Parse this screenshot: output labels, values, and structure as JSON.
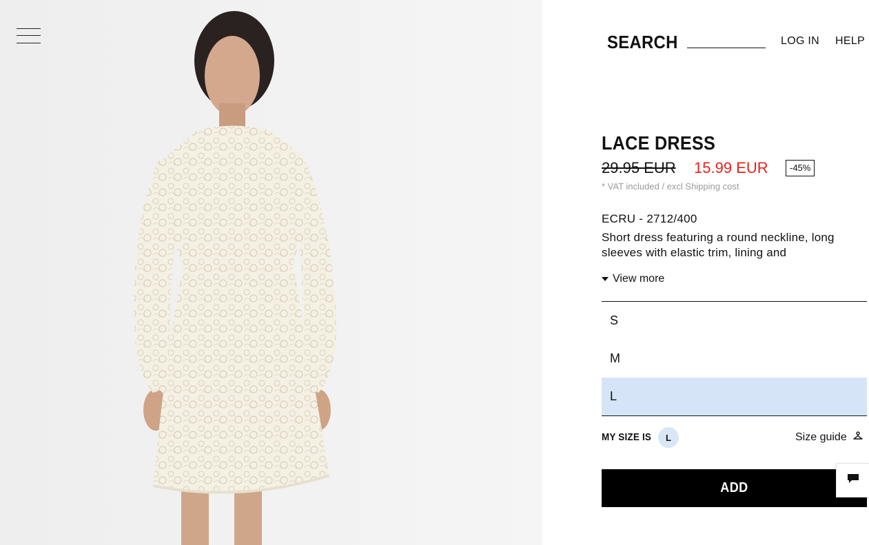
{
  "header": {
    "search_label": "SEARCH",
    "login_label": "LOG IN",
    "help_label": "HELP"
  },
  "product": {
    "name": "LACE DRESS",
    "old_price": "29.95 EUR",
    "new_price": "15.99 EUR",
    "discount": "-45%",
    "vat_note": "* VAT included / excl Shipping cost",
    "color_ref": "ECRU - 2712/400",
    "description": "Short dress featuring a round neckline, long sleeves with elastic trim, lining and",
    "view_more_label": "View more"
  },
  "sizes": {
    "options": [
      "S",
      "M",
      "L"
    ],
    "selected": "L"
  },
  "my_size": {
    "label": "MY SIZE IS",
    "value": "L"
  },
  "size_guide_label": "Size guide",
  "add_button_label": "ADD",
  "colors": {
    "sale_price": "#e3241b",
    "selected_size_bg": "#d5e5f7",
    "add_button_bg": "#000000"
  },
  "icons": {
    "menu": "hamburger-menu-icon",
    "view_more": "triangle-down-icon",
    "size_guide": "hanger-icon",
    "chat": "chat-bubble-icon"
  }
}
